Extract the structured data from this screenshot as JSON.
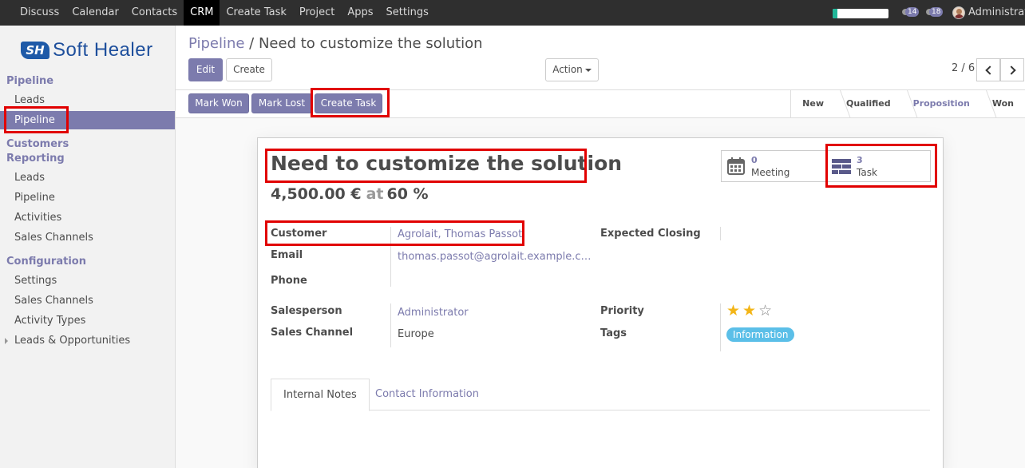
{
  "topbar": {
    "menu": [
      "Discuss",
      "Calendar",
      "Contacts",
      "CRM",
      "Create Task",
      "Project",
      "Apps",
      "Settings"
    ],
    "active_menu": "CRM",
    "activity_count": "14",
    "message_count": "18",
    "user_name": "Administrator",
    "progress_fraction": 0.08
  },
  "sidebar": {
    "logo_mark": "SH",
    "logo_text": "Soft Healer",
    "pipeline_header": "Pipeline",
    "pipeline_items": [
      "Leads",
      "Pipeline"
    ],
    "customers_header": "Customers",
    "reporting_header": "Reporting",
    "reporting_items": [
      "Leads",
      "Pipeline",
      "Activities",
      "Sales Channels"
    ],
    "config_header": "Configuration",
    "config_items": [
      "Settings",
      "Sales Channels",
      "Activity Types"
    ],
    "leads_opps": "Leads & Opportunities"
  },
  "breadcrumb": {
    "parent": "Pipeline",
    "sep": " / ",
    "current": "Need to customize the solution"
  },
  "controls": {
    "edit": "Edit",
    "create": "Create",
    "action": "Action",
    "pager": "2 / 6"
  },
  "header_buttons": {
    "mark_won": "Mark Won",
    "mark_lost": "Mark Lost",
    "create_task": "Create Task"
  },
  "stages": [
    "New",
    "Qualified",
    "Proposition",
    "Won"
  ],
  "current_stage": "Proposition",
  "record": {
    "title": "Need to customize the solution",
    "revenue": "4,500.00 €",
    "at": "at",
    "probability": "60 %",
    "meeting_count": "0",
    "meeting_label": "Meeting",
    "task_count": "3",
    "task_label": "Task"
  },
  "fields": {
    "customer_label": "Customer",
    "customer_value": "Agrolait, Thomas Passot",
    "email_label": "Email",
    "email_value": "thomas.passot@agrolait.example.c…",
    "phone_label": "Phone",
    "expected_closing_label": "Expected Closing",
    "salesperson_label": "Salesperson",
    "salesperson_value": "Administrator",
    "sales_channel_label": "Sales Channel",
    "sales_channel_value": "Europe",
    "priority_label": "Priority",
    "priority_stars": 2,
    "priority_max": 3,
    "tags_label": "Tags",
    "tag_value": "Information"
  },
  "tabs": [
    "Internal Notes",
    "Contact Information"
  ],
  "colors": {
    "brand": "#7c7bad",
    "highlight": "#e10000",
    "tag": "#5bbfe8",
    "star": "#f3b517"
  }
}
